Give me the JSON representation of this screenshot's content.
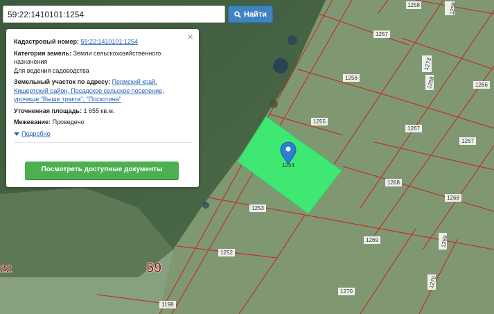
{
  "search": {
    "value": "59:22:1410101:1254",
    "button_label": "Найти"
  },
  "info_panel": {
    "cadastral_label": "Кадастровый номер:",
    "cadastral_value": "59:22:1410101:1254",
    "category_label": "Категория земель:",
    "category_value_1": "Земли сельскохозяйственного",
    "category_value_2": "назначения",
    "category_usage": "Для ведения садоводства",
    "address_label": "Земельный участок по адресу:",
    "address_1": "Пермский край,",
    "address_2": "Кишертский район, Посадское сельское поселение,",
    "address_3": "урочище \"Выше тракта\", \"Поскотина\"",
    "area_label": "Уточненная площадь:",
    "area_value": "1 655 кв.м.",
    "survey_label": "Межевание:",
    "survey_value": "Проведено",
    "more_link": "Подробно",
    "docs_button": "Посмотреть доступные документы"
  },
  "map": {
    "selected_parcel_label": "1254",
    "parcel_labels": [
      "1258",
      "1258",
      "1257",
      "1256",
      "1266",
      "1255",
      "1267",
      "1267",
      "1268",
      "1268",
      "1253",
      "1269",
      "1252",
      "1269",
      "1270",
      "1198",
      "1273",
      "1268",
      "1279"
    ],
    "district_number": "59",
    "district_number_left": "22",
    "colors": {
      "selected_parcel": "#3fe873",
      "boundary": "#c0322f",
      "marker": "#2a7fd4",
      "button": "#4caf50"
    }
  }
}
